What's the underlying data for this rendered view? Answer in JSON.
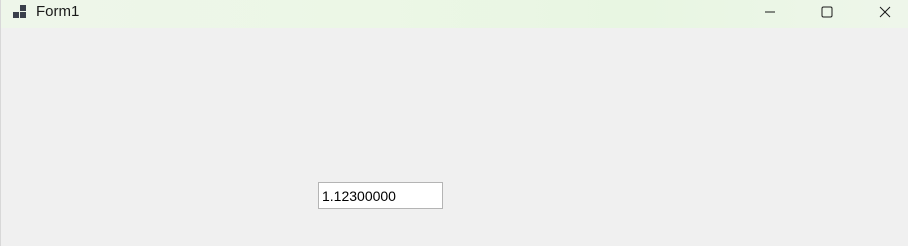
{
  "window": {
    "title": "Form1",
    "icons": {
      "app": "form-app-icon",
      "minimize": "minimize-icon",
      "maximize": "maximize-icon",
      "close": "close-icon"
    }
  },
  "form": {
    "textbox_value": "1.12300000"
  }
}
